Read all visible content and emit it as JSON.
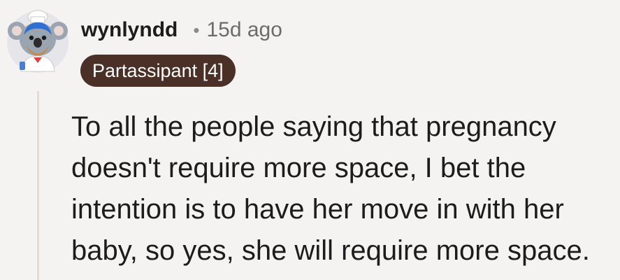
{
  "comment": {
    "username": "wynlyndd",
    "separator": "•",
    "timestamp": "15d ago",
    "flair": "Partassipant [4]",
    "body": "To all the people saying that pregnancy doesn't require more space, I bet the intention is to have her move in with her baby, so yes, she will require more space.",
    "avatar_icon": "koala-avatar-icon"
  },
  "colors": {
    "background": "#f5f3f2",
    "flair_background": "#4a3026",
    "thread_line": "#e2dbd6"
  }
}
